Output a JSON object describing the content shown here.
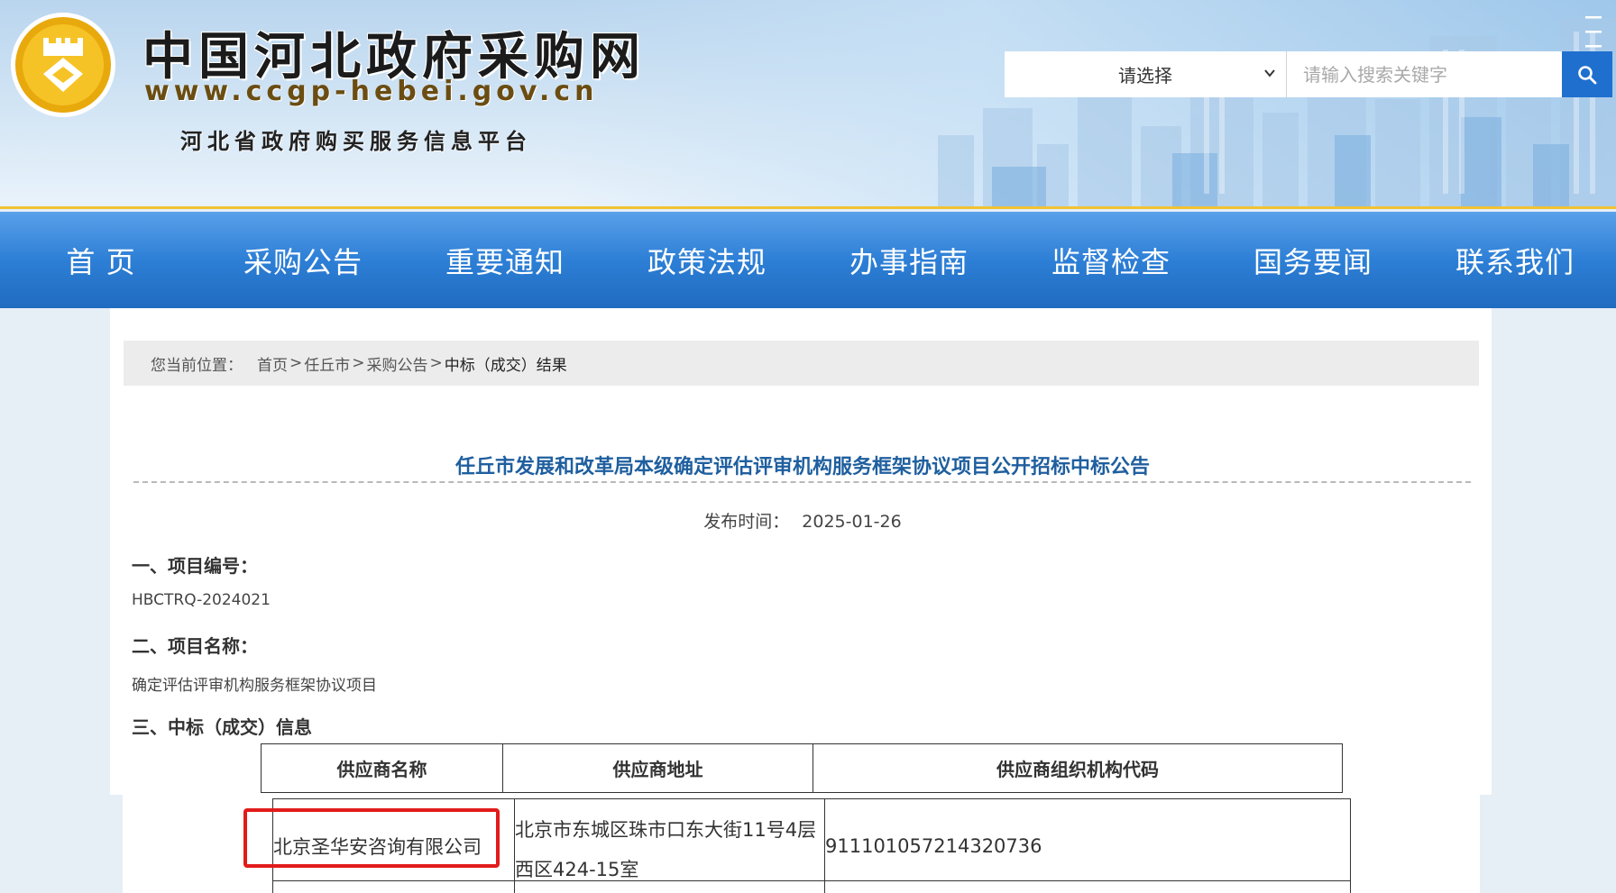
{
  "header": {
    "site_title": "中国河北政府采购网",
    "site_url": "www.ccgp-hebei.gov.cn",
    "subtitle": "河北省政府购买服务信息平台",
    "search": {
      "select_value": "请选择",
      "placeholder": "请输入搜索关键字"
    },
    "colors": {
      "nav_blue": "#2d7fd6",
      "accent_gold": "#f1c232",
      "search_button": "#1f6fcf"
    }
  },
  "nav": {
    "items": [
      "首 页",
      "采购公告",
      "重要通知",
      "政策法规",
      "办事指南",
      "监督检查",
      "国务要闻",
      "联系我们"
    ]
  },
  "breadcrumb": {
    "label": "您当前位置：",
    "items": [
      "首页",
      "任丘市",
      "采购公告"
    ],
    "separator": ">",
    "current": "中标（成交）结果"
  },
  "article": {
    "title": "任丘市发展和改革局本级确定评估评审机构服务框架协议项目公开招标中标公告",
    "publish_label": "发布时间：",
    "publish_date": "2025-01-26",
    "sections": [
      {
        "heading": "一、项目编号：",
        "value": "HBCTRQ-2024021"
      },
      {
        "heading": "二、项目名称：",
        "value": "确定评估评审机构服务框架协议项目"
      },
      {
        "heading": "三、中标（成交）信息"
      }
    ],
    "table": {
      "headers": [
        "供应商名称",
        "供应商地址",
        "供应商组织机构代码"
      ],
      "rows": [
        {
          "name": "北京圣华安咨询有限公司",
          "address_line1": "北京市东城区珠市口东大街11号4层",
          "address_line2": "西区424-15室",
          "code": "911101057214320736"
        }
      ]
    },
    "highlight_color": "#e21b1b"
  }
}
